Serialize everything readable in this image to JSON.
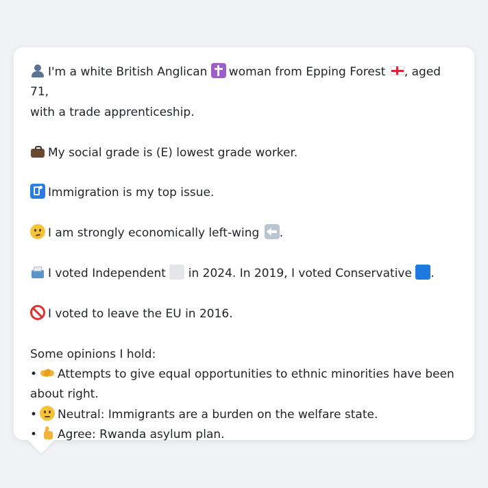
{
  "card": {
    "line_identity_1": "I'm a white British Anglican",
    "line_identity_2": "woman from Epping Forest",
    "line_identity_3": ", aged 71,",
    "line_identity_4": "with a trade apprenticeship.",
    "line_grade": "My social grade is (E) lowest grade worker.",
    "line_issue": "Immigration is my top issue.",
    "line_econ": "I am strongly economically left-wing",
    "line_econ_end": ".",
    "line_vote_1": "I voted Independent",
    "line_vote_2": "in 2024. In 2019, I voted Conservative",
    "line_vote_end": ".",
    "line_eu": "I voted to leave the EU in 2016.",
    "opinions_heading": "Some opinions I hold:",
    "opinions": [
      {
        "bullet": "•",
        "text_1": "Attempts to give equal opportunities to ethnic minorities have been",
        "text_2": "about right."
      },
      {
        "bullet": "•",
        "text_1": "Neutral: Immigrants are a burden on the welfare state."
      },
      {
        "bullet": "•",
        "text_1": "Agree: Rwanda asylum plan."
      }
    ]
  },
  "icons": {
    "identity": "bust-in-silhouette-icon",
    "religion": "latin-cross-icon",
    "region": "england-flag-icon",
    "grade": "briefcase-icon",
    "issue": "passport-control-icon",
    "econ": "thinking-face-icon",
    "econ_direction": "left-arrow-icon",
    "vote": "ballot-box-icon",
    "party_2024": "grey-square-icon",
    "party_2019": "blue-square-icon",
    "eu": "prohibited-icon",
    "opinion_1": "handshake-icon",
    "opinion_2": "neutral-face-icon",
    "opinion_3": "thumbs-up-icon"
  },
  "colors": {
    "independent": "#e4e6ea",
    "conservative": "#1f7ae0"
  }
}
